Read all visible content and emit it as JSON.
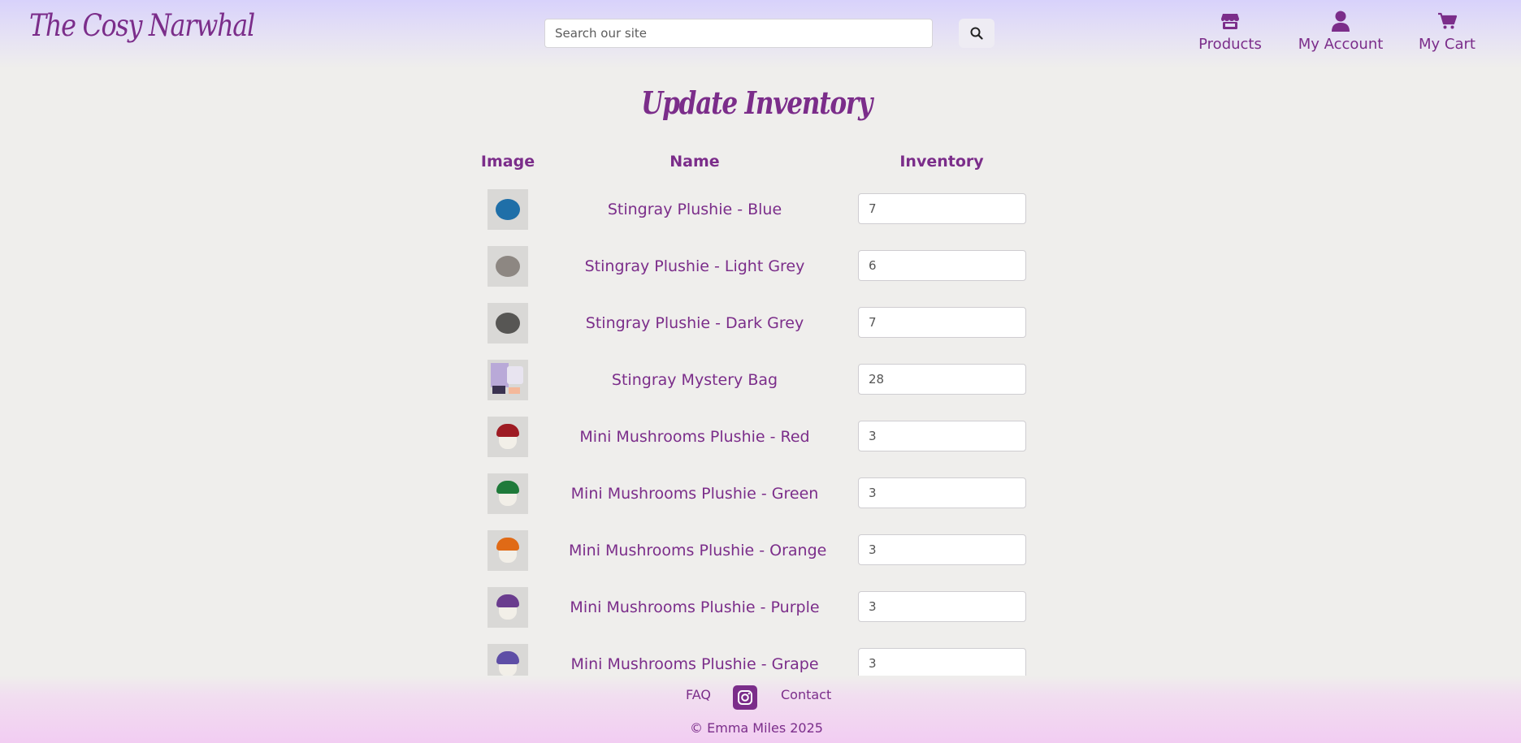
{
  "header": {
    "logo": "The Cosy Narwhal",
    "search": {
      "placeholder": "Search our site",
      "value": ""
    },
    "nav": {
      "products": "Products",
      "account": "My Account",
      "cart": "My Cart"
    }
  },
  "main": {
    "title": "Update Inventory",
    "columns": {
      "image": "Image",
      "name": "Name",
      "inventory": "Inventory"
    },
    "rows": [
      {
        "name": "Stingray Plushie - Blue",
        "inventory": "7",
        "thumb_color": "#1f6fa8"
      },
      {
        "name": "Stingray Plushie - Light Grey",
        "inventory": "6",
        "thumb_color": "#8d8782"
      },
      {
        "name": "Stingray Plushie - Dark Grey",
        "inventory": "7",
        "thumb_color": "#575654"
      },
      {
        "name": "Stingray Mystery Bag",
        "inventory": "28",
        "thumb_color": "#b9a9d8"
      },
      {
        "name": "Mini Mushrooms Plushie - Red",
        "inventory": "3",
        "thumb_color": "#9e1b23"
      },
      {
        "name": "Mini Mushrooms Plushie - Green",
        "inventory": "3",
        "thumb_color": "#1f7a3a"
      },
      {
        "name": "Mini Mushrooms Plushie - Orange",
        "inventory": "3",
        "thumb_color": "#e06a16"
      },
      {
        "name": "Mini Mushrooms Plushie - Purple",
        "inventory": "3",
        "thumb_color": "#6a3c8e"
      },
      {
        "name": "Mini Mushrooms Plushie - Grape",
        "inventory": "3",
        "thumb_color": "#5e4ea6"
      }
    ]
  },
  "footer": {
    "faq": "FAQ",
    "contact": "Contact",
    "copyright": "© Emma Miles 2025"
  },
  "theme": {
    "accent": "#7b2d8a",
    "background": "#efeeec",
    "header_gradient_top": "#d8d2fb",
    "footer_gradient_bottom": "#f2cdf2"
  }
}
